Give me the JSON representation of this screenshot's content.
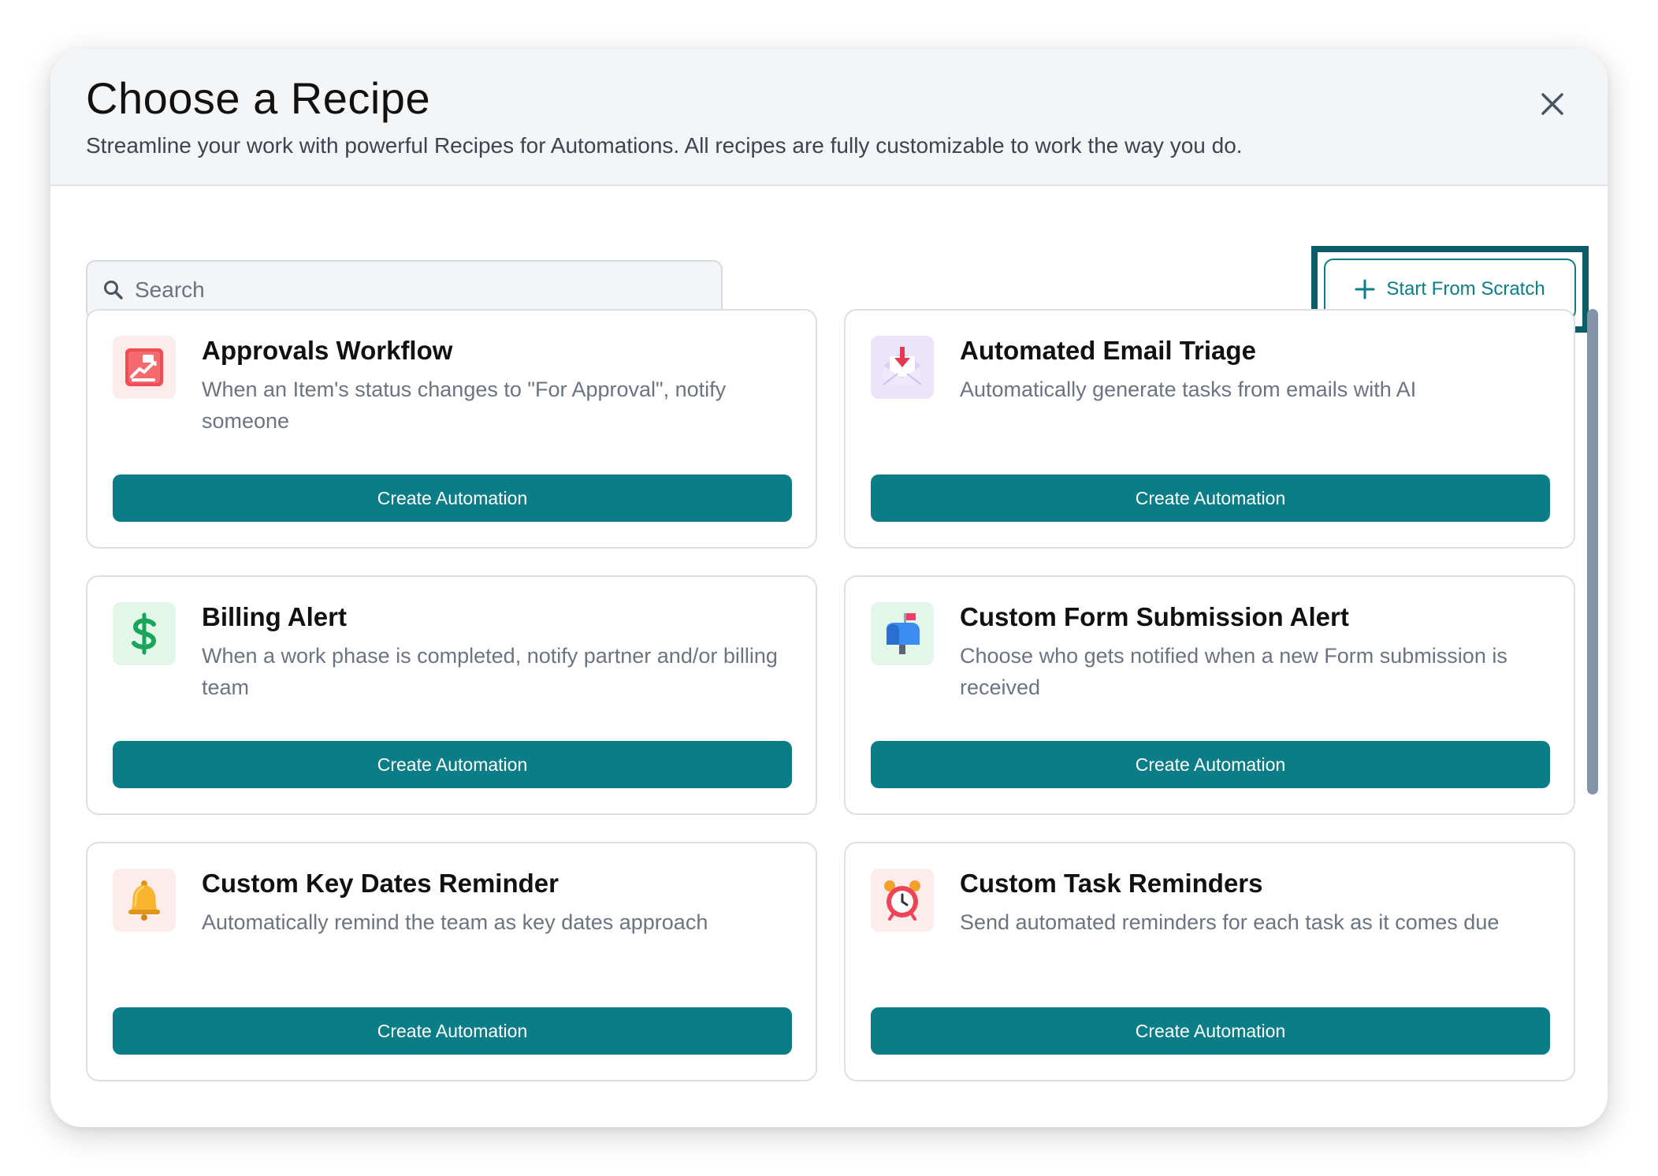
{
  "header": {
    "title": "Choose a Recipe",
    "subtitle": "Streamline your work with powerful Recipes for Automations. All recipes are fully customizable to work the way you do.",
    "close_icon": "close-icon"
  },
  "toolbar": {
    "search_placeholder": "Search",
    "search_value": "",
    "search_icon": "search-icon",
    "scratch_label": "Start From Scratch",
    "scratch_icon": "plus-icon"
  },
  "colors": {
    "accent": "#0b7d86",
    "highlight_border": "#0b5d66",
    "header_bg": "#f4f5f7",
    "text_muted": "#6b7480"
  },
  "recipes": [
    {
      "title": "Approvals Workflow",
      "description": "When an Item's status changes to \"For Approval\", notify someone",
      "icon": "approval-clipboard-icon",
      "icon_bg": "#fdecec",
      "button_label": "Create Automation"
    },
    {
      "title": "Automated Email Triage",
      "description": "Automatically generate tasks from emails with AI",
      "icon": "email-inbox-icon",
      "icon_bg": "#ece4fb",
      "button_label": "Create Automation"
    },
    {
      "title": "Billing Alert",
      "description": "When a work phase is completed, notify partner and/or billing team",
      "icon": "dollar-sign-icon",
      "icon_bg": "#e3f6ea",
      "button_label": "Create Automation"
    },
    {
      "title": "Custom Form Submission Alert",
      "description": "Choose who gets notified when a new Form submission is received",
      "icon": "mailbox-icon",
      "icon_bg": "#e3f6ea",
      "button_label": "Create Automation"
    },
    {
      "title": "Custom Key Dates Reminder",
      "description": "Automatically remind the team as key dates approach",
      "icon": "bell-icon",
      "icon_bg": "#fdecec",
      "button_label": "Create Automation"
    },
    {
      "title": "Custom Task Reminders",
      "description": "Send automated reminders for each task as it comes due",
      "icon": "alarm-clock-icon",
      "icon_bg": "#fdecec",
      "button_label": "Create Automation"
    }
  ]
}
